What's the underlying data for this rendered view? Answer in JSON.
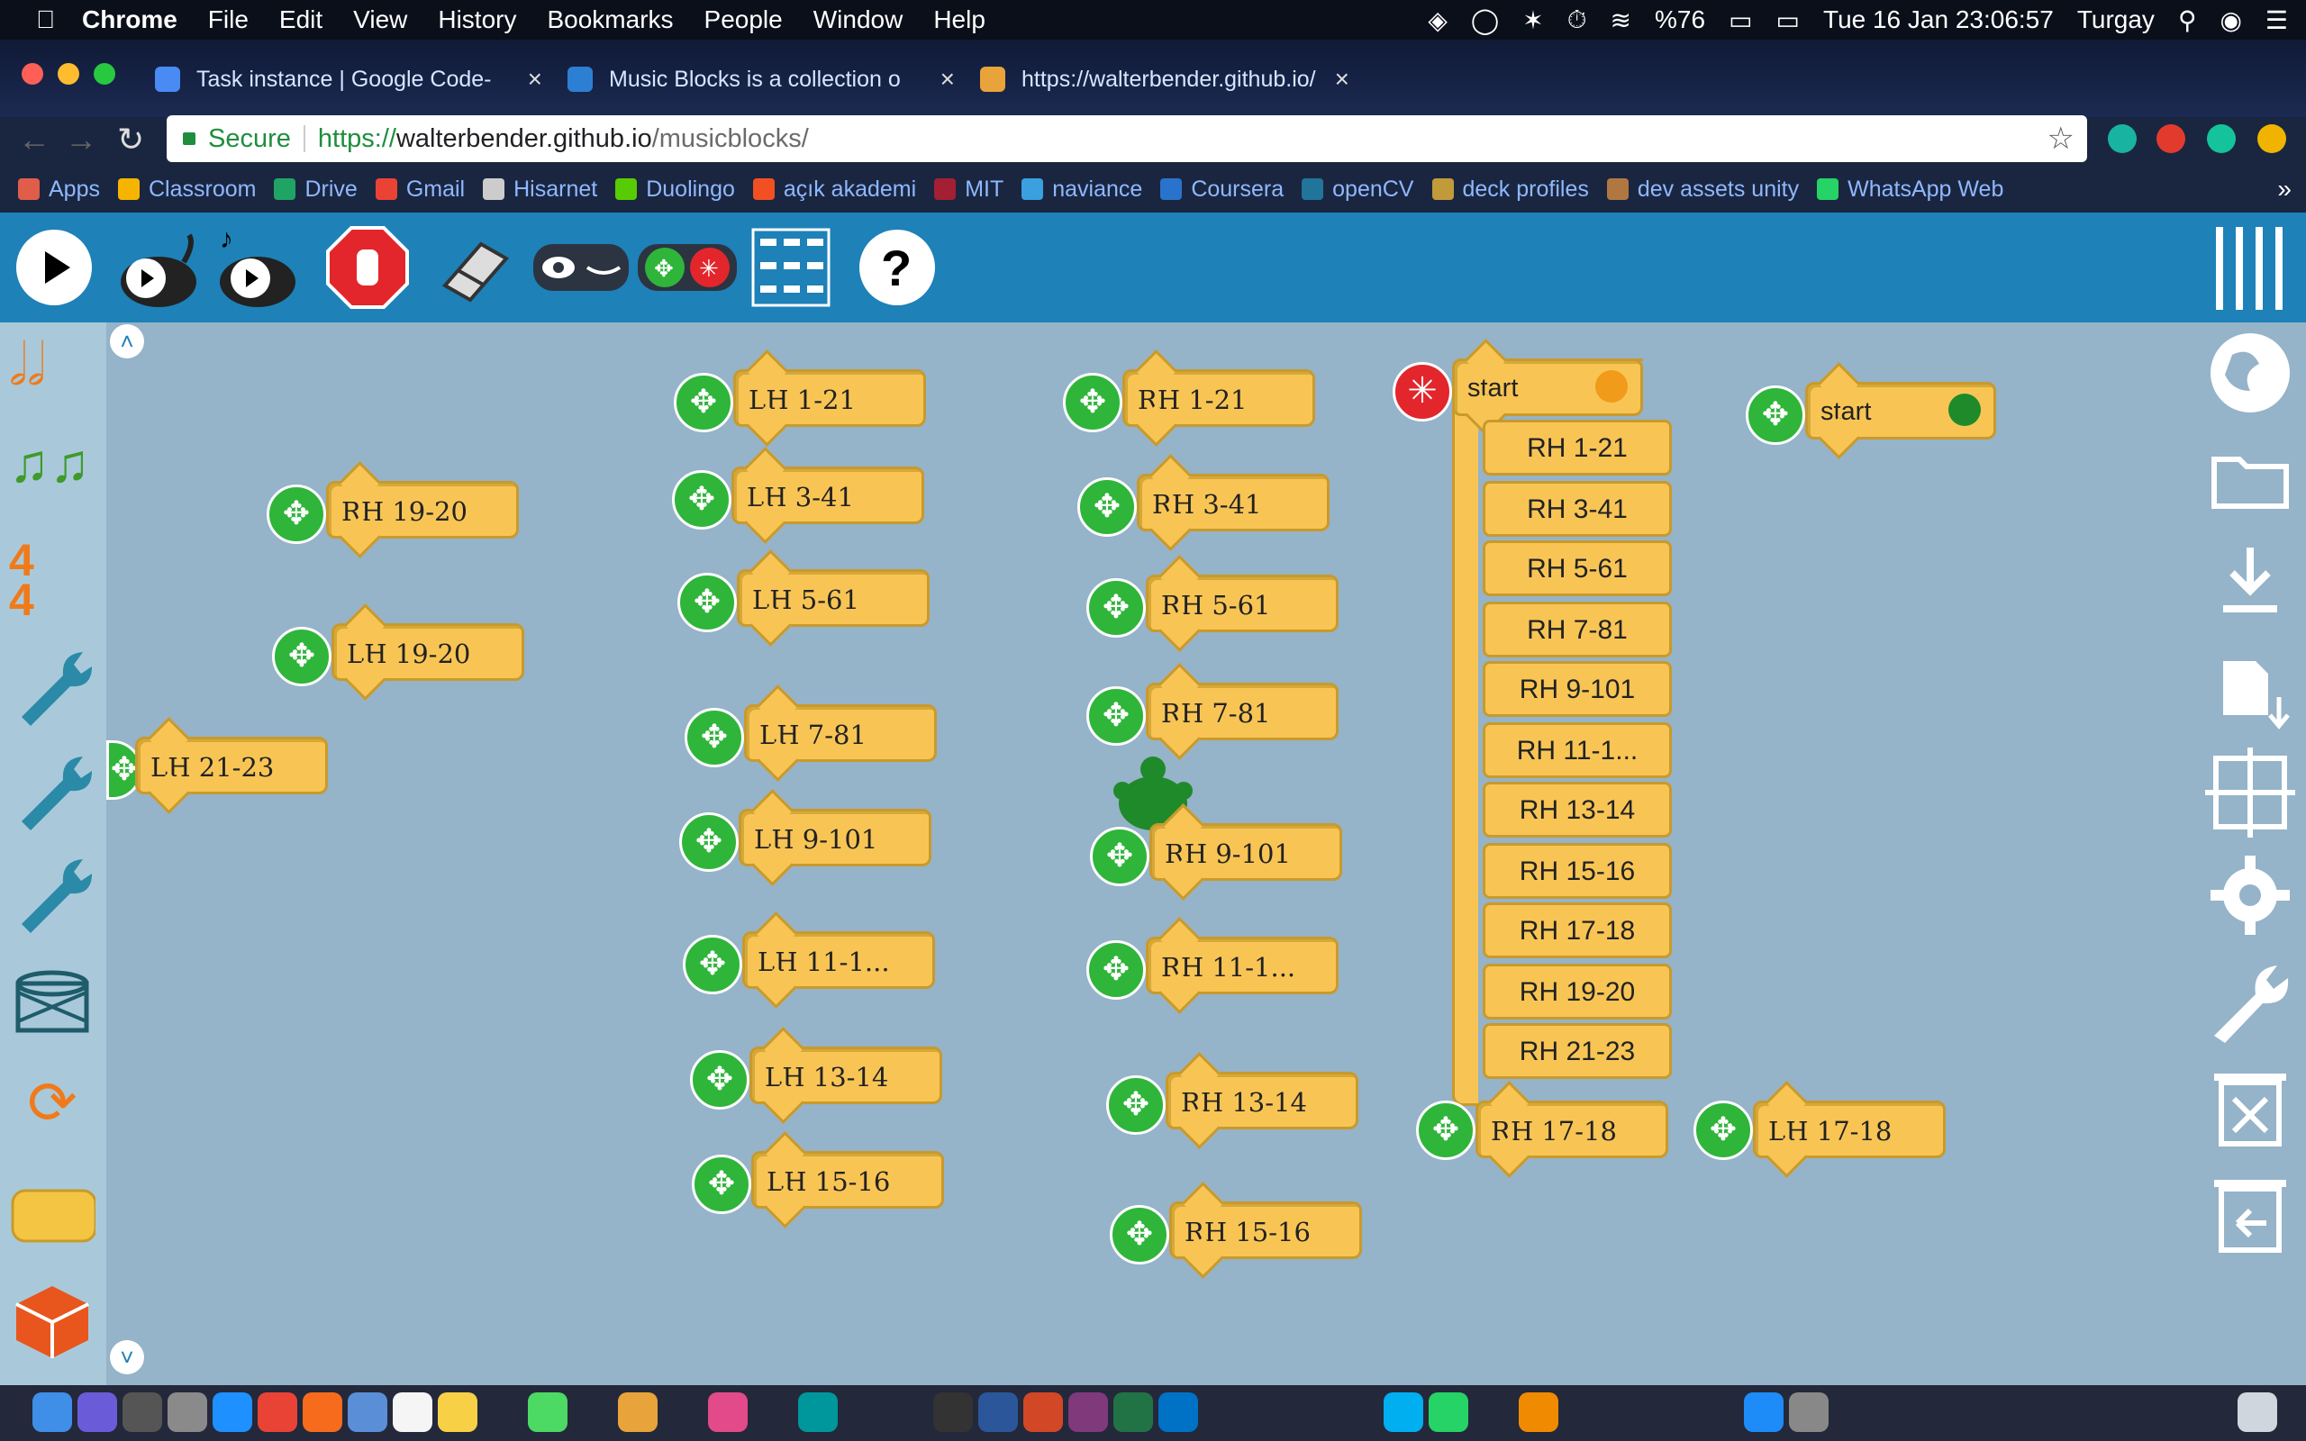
{
  "menubar": {
    "app": "Chrome",
    "items": [
      "File",
      "Edit",
      "View",
      "History",
      "Bookmarks",
      "People",
      "Window",
      "Help"
    ],
    "battery": "%76",
    "datetime": "Tue 16 Jan  23:06:57",
    "user": "Turgay"
  },
  "tabs": [
    {
      "title": "Task instance | Google Code-"
    },
    {
      "title": "Music Blocks is a collection o"
    },
    {
      "title": "https://walterbender.github.io/"
    }
  ],
  "omnibox": {
    "secure_label": "Secure",
    "scheme": "https://",
    "host": "walterbender.github.io",
    "path": "/musicblocks/"
  },
  "bookmarks": [
    "Apps",
    "Classroom",
    "Drive",
    "Gmail",
    "Hisarnet",
    "Duolingo",
    "açık akademi",
    "MIT",
    "naviance",
    "Coursera",
    "openCV",
    "deck profiles",
    "dev assets unity",
    "WhatsApp Web"
  ],
  "blocks": {
    "lh_col": [
      "LH 1-21",
      "LH 3-41",
      "LH 5-61",
      "LH 7-81",
      "LH 9-101",
      "LH 11-1...",
      "LH 13-14",
      "LH 15-16"
    ],
    "rh_col": [
      "RH 1-21",
      "RH 3-41",
      "RH 5-61",
      "RH 7-81",
      "RH 9-101",
      "RH 11-1...",
      "RH 13-14",
      "RH 15-16"
    ],
    "left_extra": [
      "RH 19-20",
      "LH 19-20",
      "LH 21-23"
    ],
    "start_label": "start",
    "stack": [
      "RH 1-21",
      "RH 3-41",
      "RH 5-61",
      "RH 7-81",
      "RH 9-101",
      "RH 11-1...",
      "RH 13-14",
      "RH 15-16",
      "RH 17-18",
      "RH 19-20",
      "RH 21-23"
    ],
    "bottom_rh": "RH 17-18",
    "bottom_lh": "LH 17-18",
    "start2_label": "start"
  },
  "colors": {
    "toolbar": "#1e81b8",
    "canvas": "#95b3c9",
    "block": "#f8c555",
    "mover": "#2fb53a",
    "stop": "#e2262c"
  }
}
